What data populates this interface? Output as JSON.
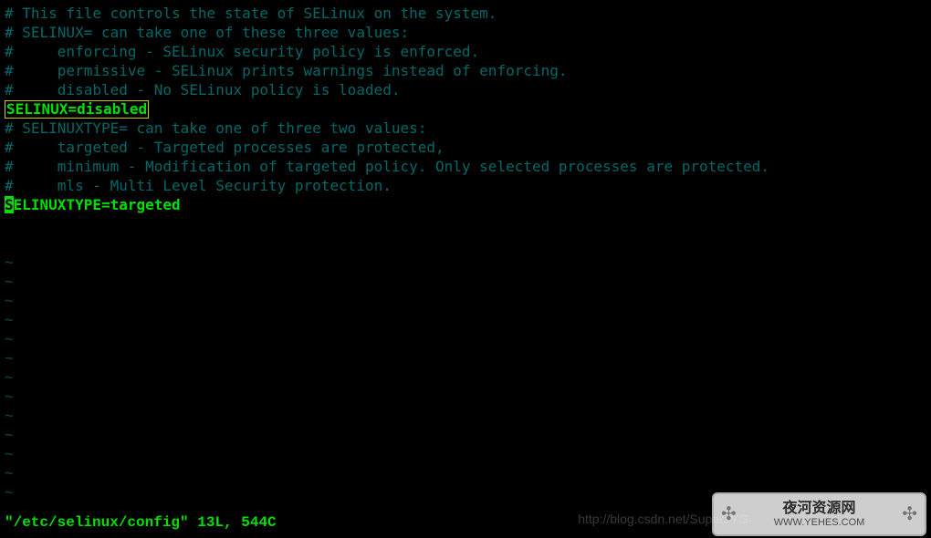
{
  "lines": {
    "c0": "# This file controls the state of SELinux on the system.",
    "c1": "# SELINUX= can take one of these three values:",
    "c2": "#     enforcing - SELinux security policy is enforced.",
    "c3": "#     permissive - SELinux prints warnings instead of enforcing.",
    "c4": "#     disabled - No SELinux policy is loaded.",
    "hl": "SELINUX=disabled",
    "c5": "# SELINUXTYPE= can take one of three two values:",
    "c6": "#     targeted - Targeted processes are protected,",
    "c7": "#     minimum - Modification of targeted policy. Only selected processes are protected.",
    "c8": "#     mls - Multi Level Security protection.",
    "active_cursor_char": "S",
    "active_rest": "ELINUXTYPE=targeted"
  },
  "tilde": "~",
  "status": "\"/etc/selinux/config\" 13L, 544C",
  "overlay_url": "http://blog.csdn.net/SuperJYG",
  "watermark": {
    "line1": "夜河资源网",
    "line2": "WWW.YEHES.COM"
  }
}
